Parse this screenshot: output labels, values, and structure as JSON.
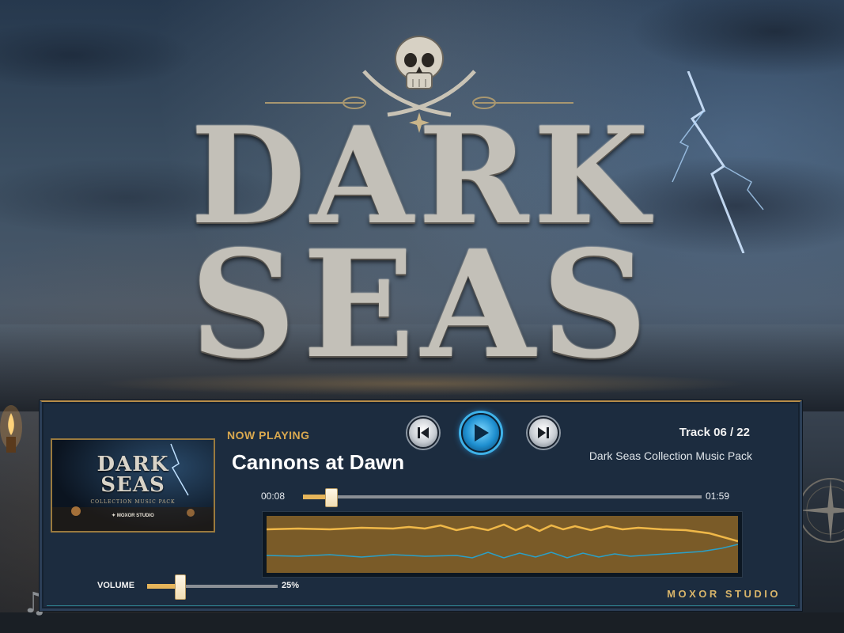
{
  "logo": {
    "line1": "DARK",
    "line2": "SEAS"
  },
  "player": {
    "now_playing_label": "NOW PLAYING",
    "track_title": "Cannons at Dawn",
    "track_number": "Track 06 / 22",
    "album_name": "Dark Seas Collection Music Pack",
    "cover": {
      "title_line1": "DARK",
      "title_line2": "SEAS",
      "subtitle": "COLLECTION MUSIC PACK",
      "studio": "✦ MOXOR STUDIO"
    },
    "controls": {
      "previous_icon": "skip-previous-icon",
      "play_icon": "play-icon",
      "next_icon": "skip-next-icon"
    },
    "progress": {
      "current_time": "00:08",
      "total_time": "01:59",
      "fraction": 0.07
    },
    "volume": {
      "label": "VOLUME",
      "value_text": "25%",
      "fraction": 0.25
    },
    "studio_label": "MOXOR STUDIO"
  },
  "colors": {
    "accent_gold": "#e6b55a",
    "panel_bg": "#1c2c3f",
    "play_blue": "#1e8fd0",
    "wave_fill": "#7a5b28",
    "wave_line_top": "#f0b848",
    "wave_line_bottom": "#2aa0c8"
  }
}
